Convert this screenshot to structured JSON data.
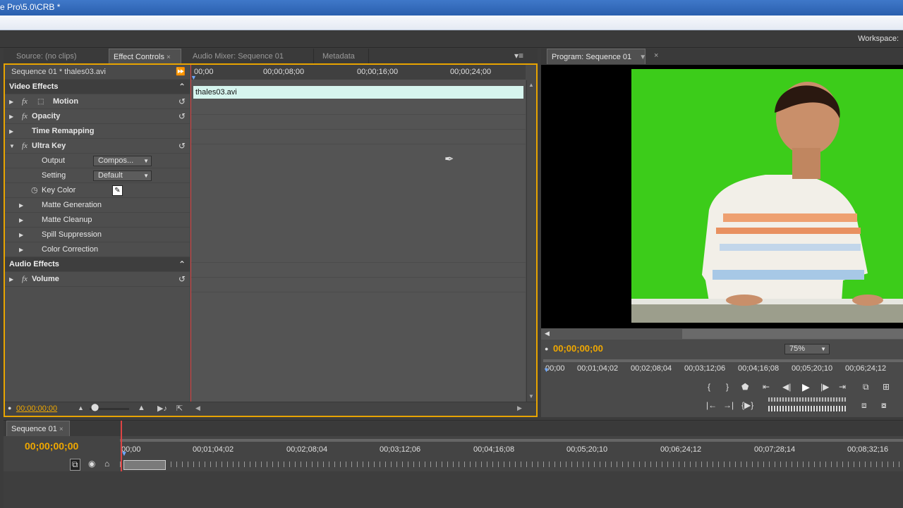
{
  "titlebar": {
    "title": "e Pro\\5.0\\CRB *"
  },
  "workspace": {
    "label": "Workspace:"
  },
  "effect_panel": {
    "tabs": [
      {
        "label": "Source: (no clips)",
        "active": false
      },
      {
        "label": "Effect Controls",
        "active": true
      },
      {
        "label": "Audio Mixer: Sequence 01",
        "active": false
      },
      {
        "label": "Metadata",
        "active": false
      }
    ],
    "sequence_label": "Sequence 01 * thales03.avi",
    "ruler_ticks": [
      "00;00",
      "00;00;08;00",
      "00;00;16;00",
      "00;00;24;00"
    ],
    "clip_name": "thales03.avi",
    "video_effects_header": "Video Effects",
    "audio_effects_header": "Audio Effects",
    "effects": {
      "motion": "Motion",
      "opacity": "Opacity",
      "time_remapping": "Time Remapping",
      "ultra_key": "Ultra Key",
      "output_label": "Output",
      "output_value": "Compos...",
      "setting_label": "Setting",
      "setting_value": "Default",
      "key_color_label": "Key Color",
      "matte_generation": "Matte Generation",
      "matte_cleanup": "Matte Cleanup",
      "spill_suppression": "Spill Suppression",
      "color_correction": "Color Correction",
      "volume": "Volume"
    },
    "timecode": "00;00;00;00"
  },
  "program_panel": {
    "tab": "Program: Sequence 01",
    "timecode": "00;00;00;00",
    "zoom": "75%",
    "ruler_ticks": [
      "00;00",
      "00;01;04;02",
      "00;02;08;04",
      "00;03;12;06",
      "00;04;16;08",
      "00;05;20;10",
      "00;06;24;12"
    ]
  },
  "sequence_panel": {
    "tab": "Sequence 01",
    "timecode": "00;00;00;00",
    "ruler_ticks": [
      "00;00",
      "00;01;04;02",
      "00;02;08;04",
      "00;03;12;06",
      "00;04;16;08",
      "00;05;20;10",
      "00;06;24;12",
      "00;07;28;14",
      "00;08;32;16"
    ]
  }
}
